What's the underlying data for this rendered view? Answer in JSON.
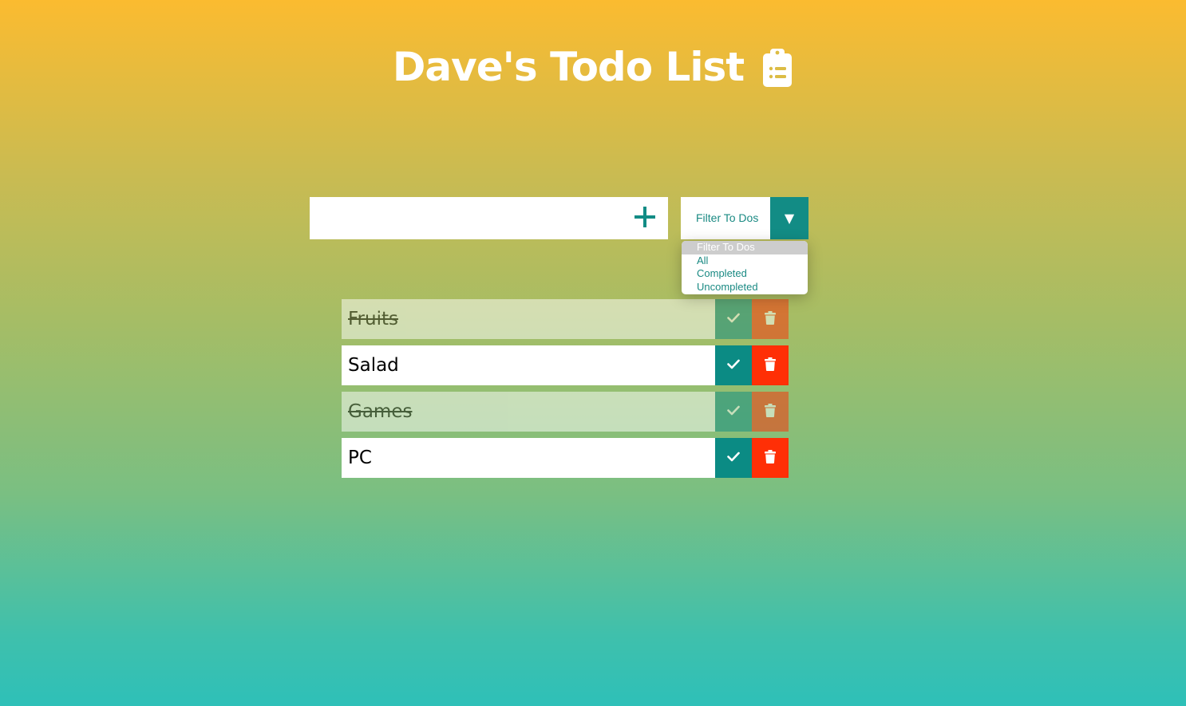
{
  "header": {
    "title": "Dave's Todo List",
    "icon": "clipboard-list-icon"
  },
  "form": {
    "input_value": "",
    "input_placeholder": "",
    "add_icon": "plus-icon"
  },
  "filter": {
    "selected": "Filter To Dos",
    "arrow_icon": "triangle-down-icon",
    "options": [
      "Filter To Dos",
      "All",
      "Completed",
      "Uncompleted"
    ]
  },
  "todos": [
    {
      "text": "Fruits",
      "completed": true
    },
    {
      "text": "Salad",
      "completed": false
    },
    {
      "text": "Games",
      "completed": true
    },
    {
      "text": "PC",
      "completed": false
    }
  ],
  "colors": {
    "gradient_top": "#fbbb30",
    "gradient_bottom": "#2ec0b8",
    "accent_teal": "#0b8b84",
    "trash_red": "#ff2f06",
    "text_teal": "#1a8a83"
  }
}
